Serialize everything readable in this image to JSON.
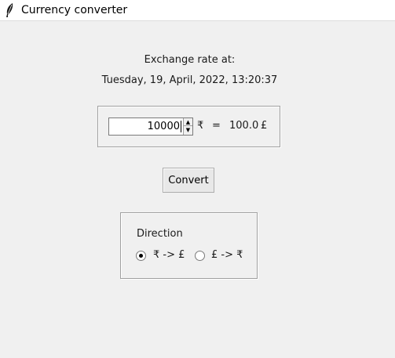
{
  "window": {
    "title": "Currency converter",
    "icon": "tk-feather-icon"
  },
  "exchange": {
    "label": "Exchange rate at:",
    "datetime": "Tuesday, 19, April, 2022, 13:20:37"
  },
  "converter": {
    "amount": "10000",
    "from_symbol": "₹",
    "equals": "=",
    "result": "100.0",
    "to_symbol": "£"
  },
  "convert_button": {
    "label": "Convert"
  },
  "direction": {
    "label": "Direction",
    "options": [
      {
        "label": "₹ -> £",
        "checked": true
      },
      {
        "label": "£ -> ₹",
        "checked": false
      }
    ]
  }
}
